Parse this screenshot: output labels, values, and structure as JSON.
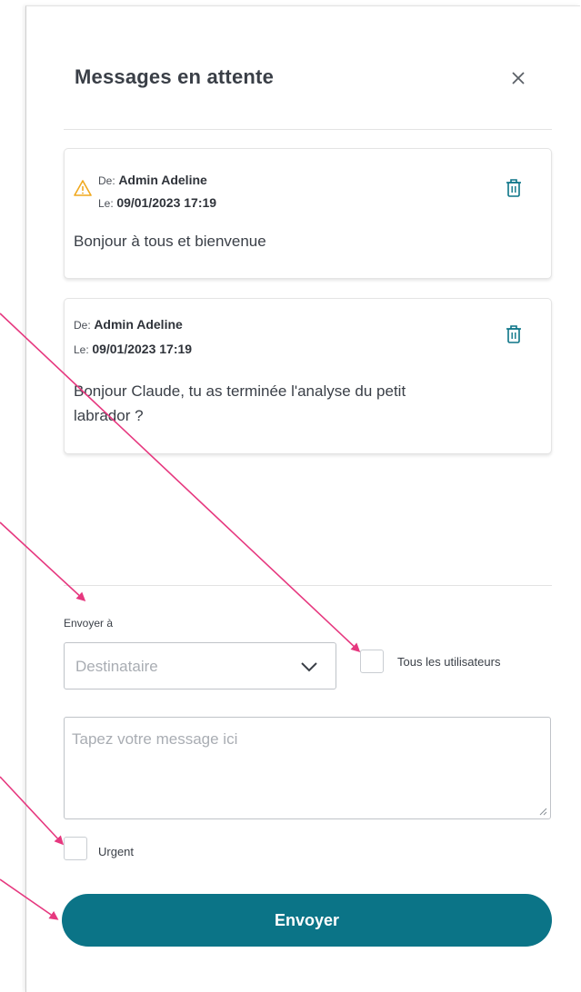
{
  "panel": {
    "title": "Messages en attente",
    "close_icon": "close-icon"
  },
  "messages": [
    {
      "urgent": true,
      "from_label": "De:",
      "from": "Admin Adeline",
      "date_label": "Le:",
      "date": "09/01/2023 17:19",
      "text": "Bonjour à tous et bienvenue"
    },
    {
      "urgent": false,
      "from_label": "De:",
      "from": "Admin Adeline",
      "date_label": "Le:",
      "date": "09/01/2023 17:19",
      "text_line1": "Bonjour Claude, tu as terminée l'analyse du petit",
      "text_line2": "labrador ?"
    }
  ],
  "compose": {
    "recipient_label": "Envoyer à",
    "recipient_placeholder": "Destinataire",
    "all_users_label": "Tous les utilisateurs",
    "message_placeholder": "Tapez votre message ici",
    "urgent_label": "Urgent",
    "send_label": "Envoyer"
  },
  "colors": {
    "accent": "#0b7487",
    "warning": "#f0a81e",
    "annotation_arrow": "#e6387f"
  }
}
